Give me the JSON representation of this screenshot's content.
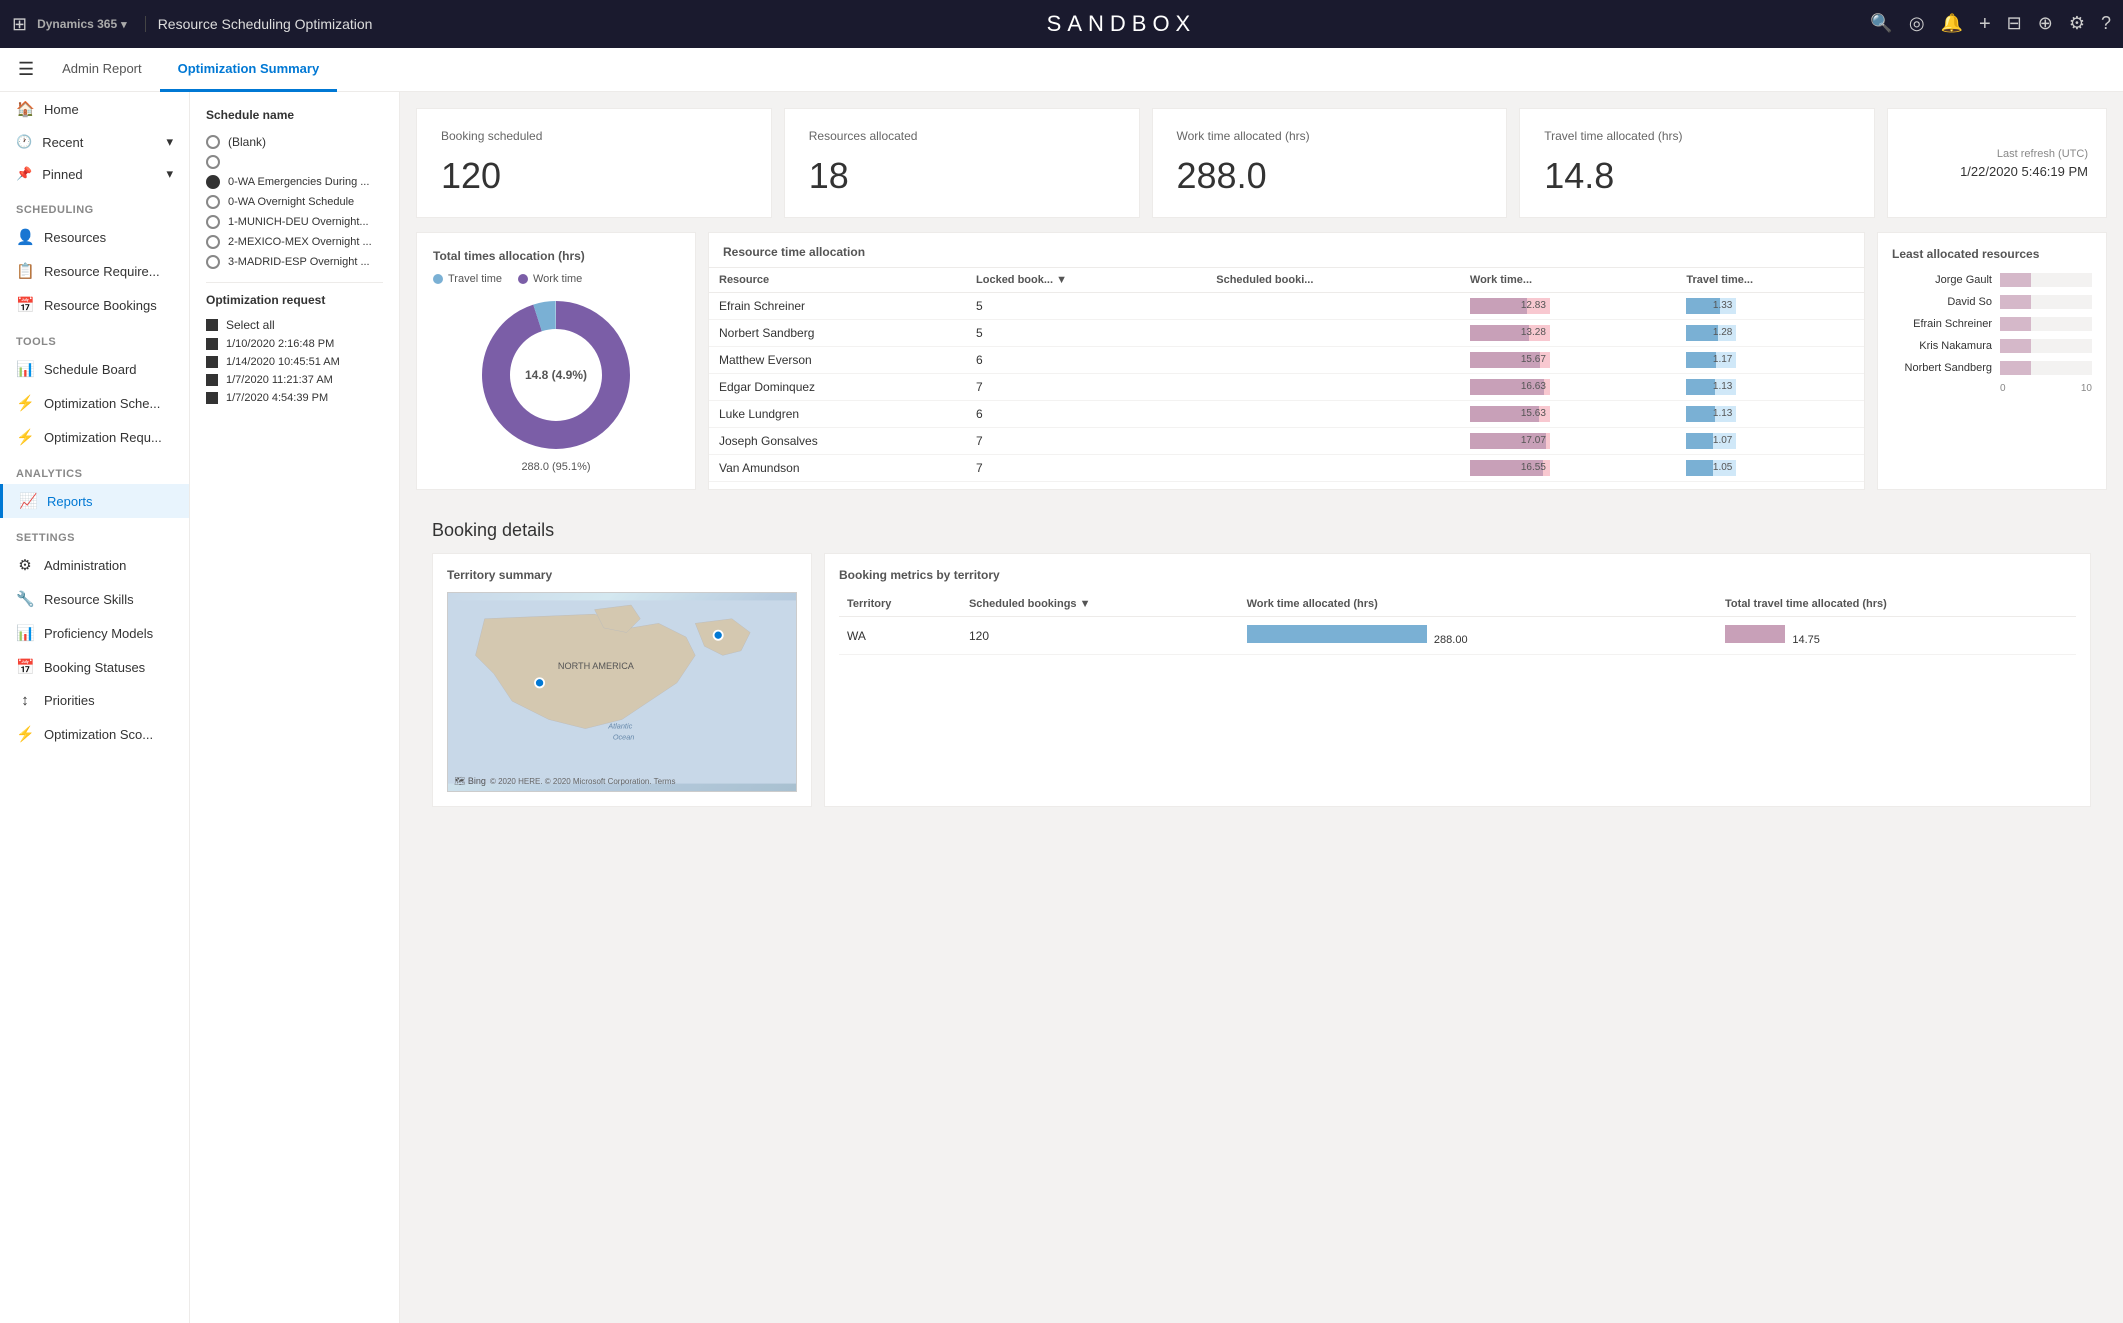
{
  "topbar": {
    "app_name": "Dynamics 365",
    "chevron": "▾",
    "page_title": "Resource Scheduling Optimization",
    "sandbox_label": "SANDBOX",
    "icons": {
      "search": "🔍",
      "target": "◎",
      "bell": "🔔",
      "plus": "+",
      "filter": "⊟",
      "add_circle": "⊕",
      "settings": "⚙",
      "help": "?"
    }
  },
  "subheader": {
    "nav_toggle": "☰",
    "tabs": [
      {
        "label": "Admin Report",
        "active": false
      },
      {
        "label": "Optimization Summary",
        "active": true
      }
    ]
  },
  "sidebar": {
    "nav_icon": "☰",
    "sections": [
      {
        "items": [
          {
            "icon": "🏠",
            "label": "Home",
            "type": "item"
          },
          {
            "icon": "🕐",
            "label": "Recent",
            "type": "group",
            "chevron": "▾"
          },
          {
            "icon": "📌",
            "label": "Pinned",
            "type": "group",
            "chevron": "▾"
          }
        ]
      },
      {
        "header": "Scheduling",
        "items": [
          {
            "icon": "👤",
            "label": "Resources",
            "type": "item"
          },
          {
            "icon": "📋",
            "label": "Resource Require...",
            "type": "item"
          },
          {
            "icon": "📅",
            "label": "Resource Bookings",
            "type": "item"
          }
        ]
      },
      {
        "header": "Tools",
        "items": [
          {
            "icon": "📊",
            "label": "Schedule Board",
            "type": "item"
          },
          {
            "icon": "⚡",
            "label": "Optimization Sche...",
            "type": "item"
          },
          {
            "icon": "⚡",
            "label": "Optimization Requ...",
            "type": "item"
          }
        ]
      },
      {
        "header": "Analytics",
        "items": [
          {
            "icon": "📈",
            "label": "Reports",
            "type": "item",
            "active": true
          }
        ]
      },
      {
        "header": "Settings",
        "items": [
          {
            "icon": "⚙",
            "label": "Administration",
            "type": "item"
          },
          {
            "icon": "🔧",
            "label": "Resource Skills",
            "type": "item"
          },
          {
            "icon": "📊",
            "label": "Proficiency Models",
            "type": "item"
          },
          {
            "icon": "📅",
            "label": "Booking Statuses",
            "type": "item"
          },
          {
            "icon": "↕",
            "label": "Priorities",
            "type": "item"
          },
          {
            "icon": "⚡",
            "label": "Optimization Sco...",
            "type": "item"
          }
        ]
      }
    ]
  },
  "filter": {
    "schedule_name_label": "Schedule name",
    "schedules": [
      {
        "label": "(Blank)",
        "type": "radio"
      },
      {
        "label": "",
        "type": "radio"
      },
      {
        "label": "0-WA Emergencies During ...",
        "type": "radio",
        "filled": true
      },
      {
        "label": "0-WA Overnight Schedule",
        "type": "radio",
        "filled": false
      },
      {
        "label": "1-MUNICH-DEU Overnight...",
        "type": "radio"
      },
      {
        "label": "2-MEXICO-MEX Overnight ...",
        "type": "radio"
      },
      {
        "label": "3-MADRID-ESP Overnight ...",
        "type": "radio"
      }
    ],
    "optimization_request_label": "Optimization request",
    "requests": [
      {
        "label": "Select all",
        "checked": true
      },
      {
        "label": "1/10/2020 2:16:48 PM",
        "checked": true
      },
      {
        "label": "1/14/2020 10:45:51 AM",
        "checked": true
      },
      {
        "label": "1/7/2020 11:21:37 AM",
        "checked": true
      },
      {
        "label": "1/7/2020 4:54:39 PM",
        "checked": true
      }
    ]
  },
  "kpis": [
    {
      "label": "Booking scheduled",
      "value": "120"
    },
    {
      "label": "Resources allocated",
      "value": "18"
    },
    {
      "label": "Work time allocated (hrs)",
      "value": "288.0"
    },
    {
      "label": "Travel time allocated (hrs)",
      "value": "14.8"
    }
  ],
  "refresh": {
    "label": "Last refresh (UTC)",
    "value": "1/22/2020 5:46:19 PM"
  },
  "donut_chart": {
    "title": "Total times allocation (hrs)",
    "legend": [
      {
        "label": "Travel time",
        "color": "#7ab0d4"
      },
      {
        "label": "Work time",
        "color": "#7b5ea7"
      }
    ],
    "segments": [
      {
        "label": "14.8 (4.9%)",
        "color": "#7ab0d4",
        "pct": 4.9
      },
      {
        "label": "288.0 (95.1%)",
        "color": "#7b5ea7",
        "pct": 95.1
      }
    ]
  },
  "resource_table": {
    "title": "Resource time allocation",
    "columns": [
      "Resource",
      "Locked book...",
      "Scheduled booki...",
      "Work time...",
      "Travel time..."
    ],
    "rows": [
      {
        "resource": "Efrain Schreiner",
        "locked": 5,
        "scheduled": "",
        "work": 12.83,
        "travel": 1.33
      },
      {
        "resource": "Norbert Sandberg",
        "locked": 5,
        "scheduled": "",
        "work": 13.28,
        "travel": 1.28
      },
      {
        "resource": "Matthew Everson",
        "locked": 6,
        "scheduled": "",
        "work": 15.67,
        "travel": 1.17
      },
      {
        "resource": "Edgar Dominquez",
        "locked": 7,
        "scheduled": "",
        "work": 16.63,
        "travel": 1.13
      },
      {
        "resource": "Luke Lundgren",
        "locked": 6,
        "scheduled": "",
        "work": 15.63,
        "travel": 1.13
      },
      {
        "resource": "Joseph Gonsalves",
        "locked": 7,
        "scheduled": "",
        "work": 17.07,
        "travel": 1.07
      },
      {
        "resource": "Van Amundson",
        "locked": 7,
        "scheduled": "",
        "work": 16.55,
        "travel": 1.05
      }
    ]
  },
  "least_allocated": {
    "title": "Least allocated resources",
    "items": [
      {
        "name": "Jorge Gault",
        "value": 5,
        "max": 15
      },
      {
        "name": "David So",
        "value": 5,
        "max": 15
      },
      {
        "name": "Efrain Schreiner",
        "value": 5,
        "max": 15
      },
      {
        "name": "Kris Nakamura",
        "value": 5,
        "max": 15
      },
      {
        "name": "Norbert Sandberg",
        "value": 5,
        "max": 15
      }
    ],
    "axis_min": "0",
    "axis_max": "10"
  },
  "booking_details": {
    "title": "Booking details",
    "territory_summary": {
      "title": "Territory summary",
      "map_label": "NORTH AMERICA",
      "bing_label": "Bing",
      "copyright": "© 2020 HERE. © 2020 Microsoft Corporation.",
      "terms": "Terms"
    },
    "metrics": {
      "title": "Booking metrics by territory",
      "columns": [
        "Territory",
        "Scheduled bookings",
        "Work time allocated (hrs)",
        "Total travel time allocated (hrs)"
      ],
      "rows": [
        {
          "territory": "WA",
          "scheduled": 120,
          "work": "288.00",
          "travel": "14.75"
        }
      ]
    }
  }
}
